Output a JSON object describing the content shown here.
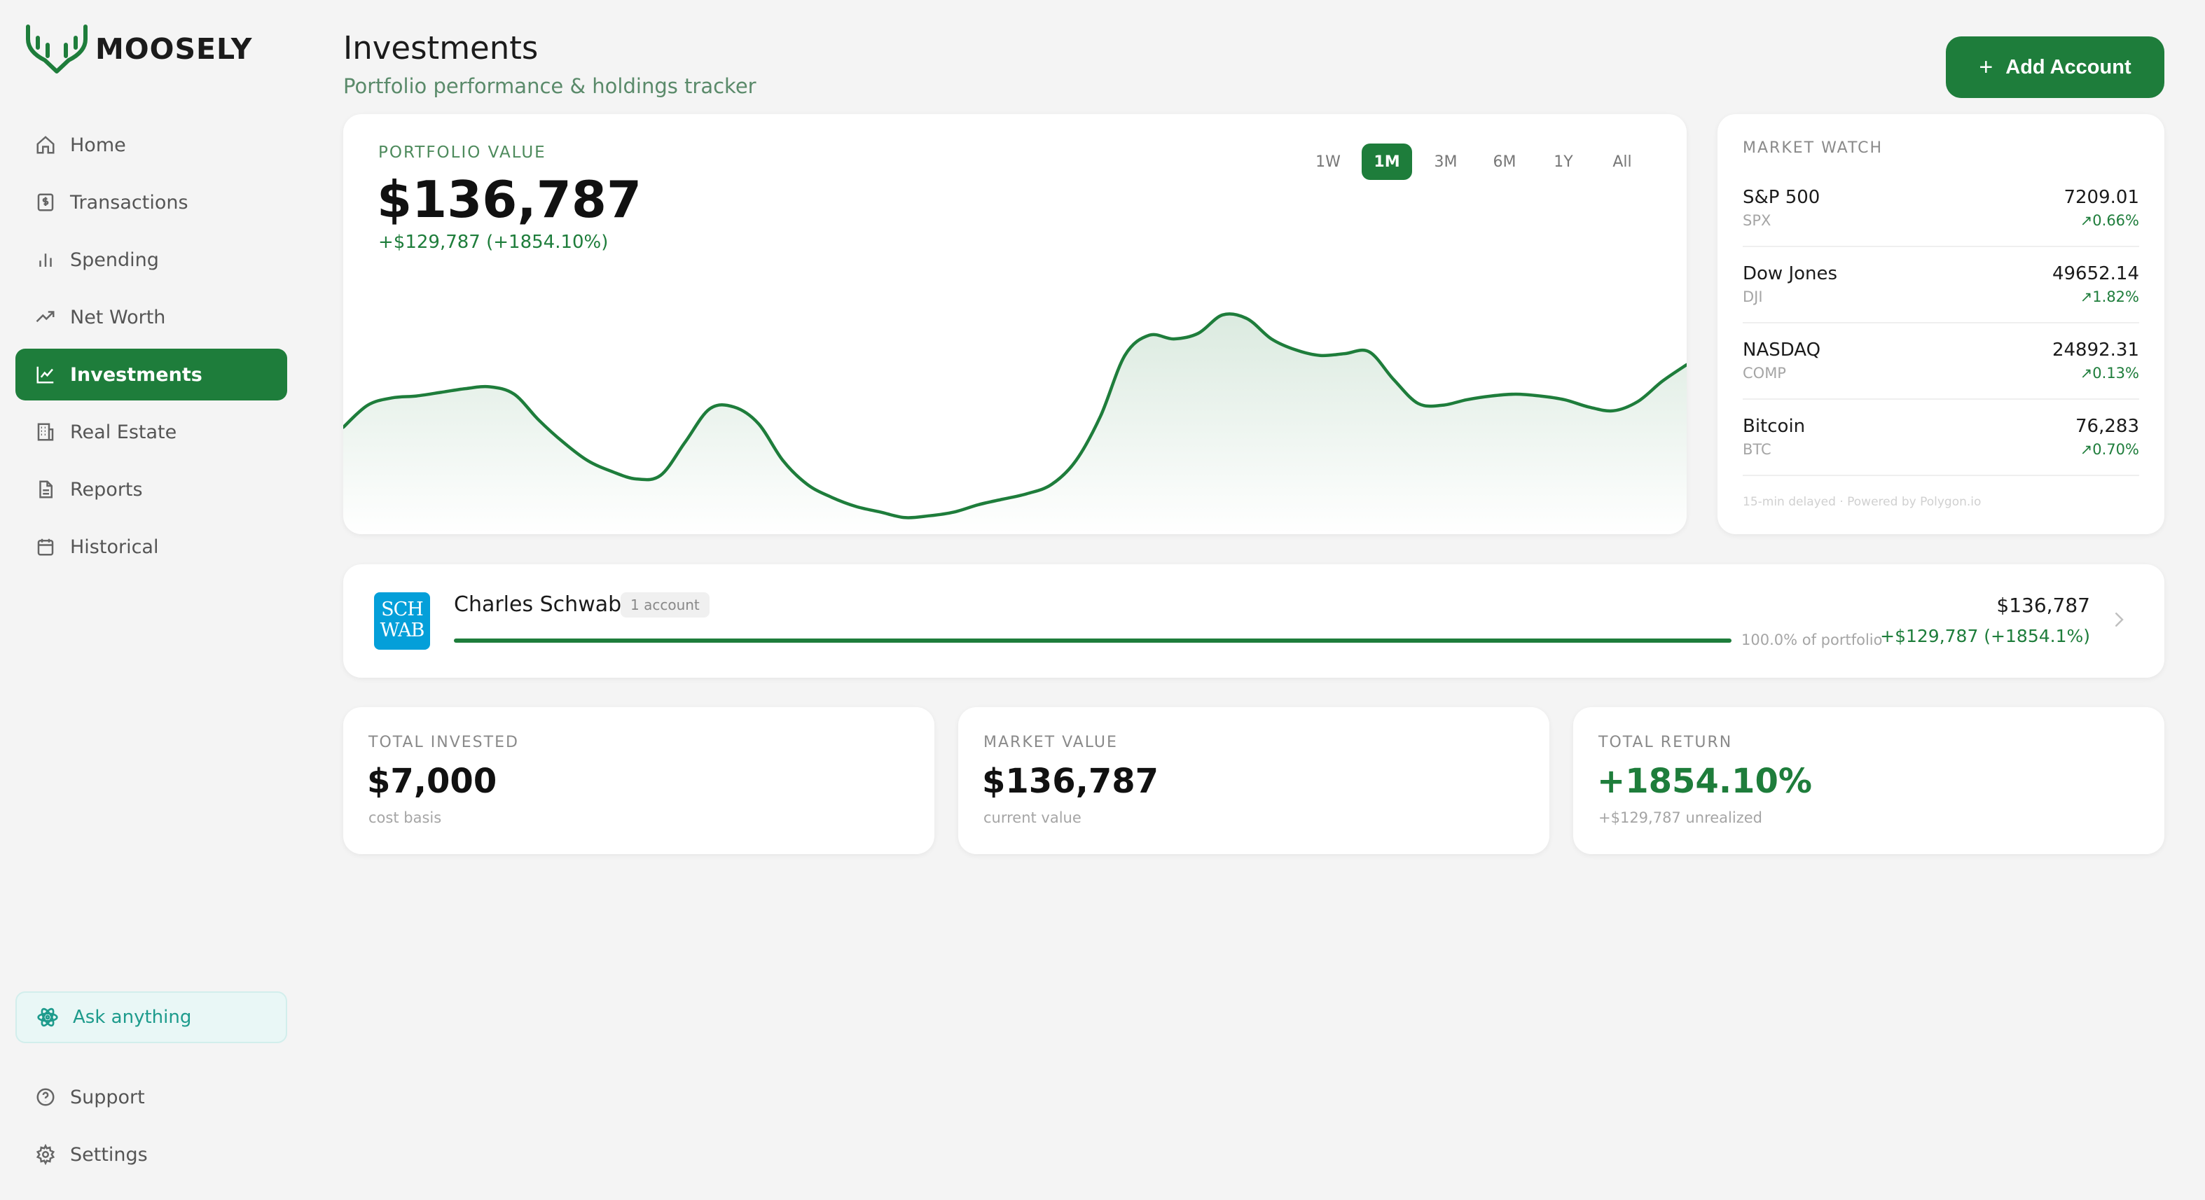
{
  "app": {
    "name": "MOOSELY"
  },
  "sidebar": {
    "items": [
      {
        "label": "Home",
        "icon": "home-icon"
      },
      {
        "label": "Transactions",
        "icon": "receipt-icon"
      },
      {
        "label": "Spending",
        "icon": "bar-chart-icon"
      },
      {
        "label": "Net Worth",
        "icon": "trend-up-icon"
      },
      {
        "label": "Investments",
        "icon": "line-chart-icon",
        "active": true
      },
      {
        "label": "Real Estate",
        "icon": "building-icon"
      },
      {
        "label": "Reports",
        "icon": "document-icon"
      },
      {
        "label": "Historical",
        "icon": "calendar-icon"
      }
    ],
    "ask_label": "Ask anything",
    "bottom": [
      {
        "label": "Support",
        "icon": "help-circle-icon"
      },
      {
        "label": "Settings",
        "icon": "gear-icon"
      }
    ]
  },
  "header": {
    "title": "Investments",
    "subtitle": "Portfolio performance & holdings tracker",
    "add_button": "Add Account"
  },
  "portfolio": {
    "label": "PORTFOLIO VALUE",
    "value": "$136,787",
    "change": "+$129,787 (+1854.10%)",
    "ranges": [
      "1W",
      "1M",
      "3M",
      "6M",
      "1Y",
      "All"
    ],
    "active_range": "1M"
  },
  "chart_data": {
    "type": "area",
    "series": [
      {
        "values": [
          46,
          58,
          62,
          63,
          65,
          67,
          68,
          64,
          50,
          38,
          28,
          22,
          18,
          20,
          38,
          56,
          57,
          48,
          28,
          15,
          8,
          3,
          0,
          -3,
          -2,
          0,
          4,
          7,
          10,
          15,
          28,
          52,
          85,
          96,
          94,
          97,
          107,
          105,
          94,
          88,
          85,
          86,
          87,
          72,
          59,
          58,
          61,
          63,
          64,
          63,
          61,
          57,
          55,
          60,
          71,
          80
        ]
      }
    ],
    "ylim": [
      -12,
      140
    ],
    "grid": false,
    "color": "#1e7d3b"
  },
  "market_watch": {
    "title": "MARKET WATCH",
    "rows": [
      {
        "name": "S&P 500",
        "symbol": "SPX",
        "value": "7209.01",
        "change": "↗0.66%"
      },
      {
        "name": "Dow Jones",
        "symbol": "DJI",
        "value": "49652.14",
        "change": "↗1.82%"
      },
      {
        "name": "NASDAQ",
        "symbol": "COMP",
        "value": "24892.31",
        "change": "↗0.13%"
      },
      {
        "name": "Bitcoin",
        "symbol": "BTC",
        "value": "76,283",
        "change": "↗0.70%"
      }
    ],
    "footer": "15-min delayed · Powered by Polygon.io"
  },
  "account": {
    "logo_top": "SCH",
    "logo_bottom": "WAB",
    "name": "Charles Schwab",
    "badge": "1 account",
    "portfolio_pct": "100.0% of portfolio",
    "portfolio_fraction": 1.0,
    "value": "$136,787",
    "change": "+$129,787 (+1854.1%)"
  },
  "stats": [
    {
      "label": "TOTAL INVESTED",
      "value": "$7,000",
      "sub": "cost basis",
      "positive": false
    },
    {
      "label": "MARKET VALUE",
      "value": "$136,787",
      "sub": "current value",
      "positive": false
    },
    {
      "label": "TOTAL RETURN",
      "value": "+1854.10%",
      "sub": "+$129,787 unrealized",
      "positive": true
    }
  ],
  "colors": {
    "accent": "#1e7d3b",
    "ask": "#1d9b8c",
    "schwab": "#049fd9"
  }
}
